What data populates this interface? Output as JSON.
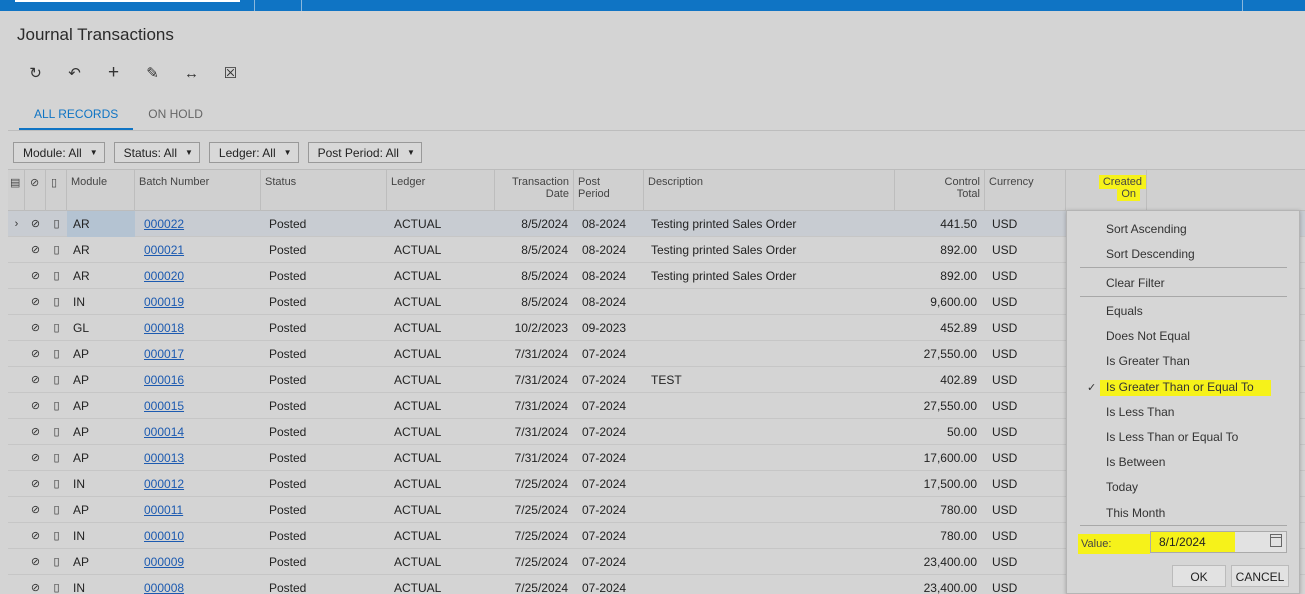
{
  "window": {
    "title": "Journal Transactions"
  },
  "toolbar": {
    "buttons": [
      {
        "name": "refresh",
        "icon": "refresh-icon",
        "glyph": "↻"
      },
      {
        "name": "undo",
        "icon": "undo-icon",
        "glyph": "↶"
      },
      {
        "name": "add",
        "icon": "plus-icon",
        "glyph": "+"
      },
      {
        "name": "edit",
        "icon": "pencil-icon",
        "glyph": "✎"
      },
      {
        "name": "fit-columns",
        "icon": "fit-width-icon",
        "glyph": "↔"
      },
      {
        "name": "export-excel",
        "icon": "excel-icon",
        "glyph": "☒"
      }
    ]
  },
  "tabs": [
    {
      "label": "ALL RECORDS",
      "active": true
    },
    {
      "label": "ON HOLD",
      "active": false
    }
  ],
  "filters": [
    {
      "label": "Module: All"
    },
    {
      "label": "Status: All"
    },
    {
      "label": "Ledger: All"
    },
    {
      "label": "Post Period: All"
    }
  ],
  "columns": {
    "module": "Module",
    "batch": "Batch Number",
    "status": "Status",
    "ledger": "Ledger",
    "tran_date_1": "Transaction",
    "tran_date_2": "Date",
    "post_period_1": "Post",
    "post_period_2": "Period",
    "description": "Description",
    "control_total_1": "Control",
    "control_total_2": "Total",
    "currency": "Currency",
    "created_on_1": "Created",
    "created_on_2": "On"
  },
  "rows": [
    {
      "module": "AR",
      "batch": "000022",
      "status": "Posted",
      "ledger": "ACTUAL",
      "date": "8/5/2024",
      "period": "08-2024",
      "description": "Testing printed Sales Order",
      "total": "441.50",
      "currency": "USD"
    },
    {
      "module": "AR",
      "batch": "000021",
      "status": "Posted",
      "ledger": "ACTUAL",
      "date": "8/5/2024",
      "period": "08-2024",
      "description": "Testing printed Sales Order",
      "total": "892.00",
      "currency": "USD"
    },
    {
      "module": "AR",
      "batch": "000020",
      "status": "Posted",
      "ledger": "ACTUAL",
      "date": "8/5/2024",
      "period": "08-2024",
      "description": "Testing printed Sales Order",
      "total": "892.00",
      "currency": "USD"
    },
    {
      "module": "IN",
      "batch": "000019",
      "status": "Posted",
      "ledger": "ACTUAL",
      "date": "8/5/2024",
      "period": "08-2024",
      "description": "",
      "total": "9,600.00",
      "currency": "USD"
    },
    {
      "module": "GL",
      "batch": "000018",
      "status": "Posted",
      "ledger": "ACTUAL",
      "date": "10/2/2023",
      "period": "09-2023",
      "description": "",
      "total": "452.89",
      "currency": "USD"
    },
    {
      "module": "AP",
      "batch": "000017",
      "status": "Posted",
      "ledger": "ACTUAL",
      "date": "7/31/2024",
      "period": "07-2024",
      "description": "",
      "total": "27,550.00",
      "currency": "USD"
    },
    {
      "module": "AP",
      "batch": "000016",
      "status": "Posted",
      "ledger": "ACTUAL",
      "date": "7/31/2024",
      "period": "07-2024",
      "description": "TEST",
      "total": "402.89",
      "currency": "USD"
    },
    {
      "module": "AP",
      "batch": "000015",
      "status": "Posted",
      "ledger": "ACTUAL",
      "date": "7/31/2024",
      "period": "07-2024",
      "description": "",
      "total": "27,550.00",
      "currency": "USD"
    },
    {
      "module": "AP",
      "batch": "000014",
      "status": "Posted",
      "ledger": "ACTUAL",
      "date": "7/31/2024",
      "period": "07-2024",
      "description": "",
      "total": "50.00",
      "currency": "USD"
    },
    {
      "module": "AP",
      "batch": "000013",
      "status": "Posted",
      "ledger": "ACTUAL",
      "date": "7/31/2024",
      "period": "07-2024",
      "description": "",
      "total": "17,600.00",
      "currency": "USD"
    },
    {
      "module": "IN",
      "batch": "000012",
      "status": "Posted",
      "ledger": "ACTUAL",
      "date": "7/25/2024",
      "period": "07-2024",
      "description": "",
      "total": "17,500.00",
      "currency": "USD"
    },
    {
      "module": "AP",
      "batch": "000011",
      "status": "Posted",
      "ledger": "ACTUAL",
      "date": "7/25/2024",
      "period": "07-2024",
      "description": "",
      "total": "780.00",
      "currency": "USD"
    },
    {
      "module": "IN",
      "batch": "000010",
      "status": "Posted",
      "ledger": "ACTUAL",
      "date": "7/25/2024",
      "period": "07-2024",
      "description": "",
      "total": "780.00",
      "currency": "USD"
    },
    {
      "module": "AP",
      "batch": "000009",
      "status": "Posted",
      "ledger": "ACTUAL",
      "date": "7/25/2024",
      "period": "07-2024",
      "description": "",
      "total": "23,400.00",
      "currency": "USD"
    },
    {
      "module": "IN",
      "batch": "000008",
      "status": "Posted",
      "ledger": "ACTUAL",
      "date": "7/25/2024",
      "period": "07-2024",
      "description": "",
      "total": "23,400.00",
      "currency": "USD"
    }
  ],
  "column_menu": {
    "sort_ascending": "Sort Ascending",
    "sort_descending": "Sort Descending",
    "clear_filter": "Clear Filter",
    "conditions": [
      {
        "label": "Equals",
        "checked": false
      },
      {
        "label": "Does Not Equal",
        "checked": false
      },
      {
        "label": "Is Greater Than",
        "checked": false
      },
      {
        "label": "Is Greater Than or Equal To",
        "checked": true
      },
      {
        "label": "Is Less Than",
        "checked": false
      },
      {
        "label": "Is Less Than or Equal To",
        "checked": false
      },
      {
        "label": "Is Between",
        "checked": false
      },
      {
        "label": "Today",
        "checked": false
      },
      {
        "label": "This Month",
        "checked": false
      }
    ],
    "check_glyph": "✓",
    "value_label": "Value:",
    "value": "8/1/2024",
    "ok": "OK",
    "cancel": "CANCEL"
  },
  "colors": {
    "accent": "#0f74c4",
    "link": "#1c5ab0",
    "highlight": "#f6f21a",
    "background": "#d4d4d4"
  }
}
